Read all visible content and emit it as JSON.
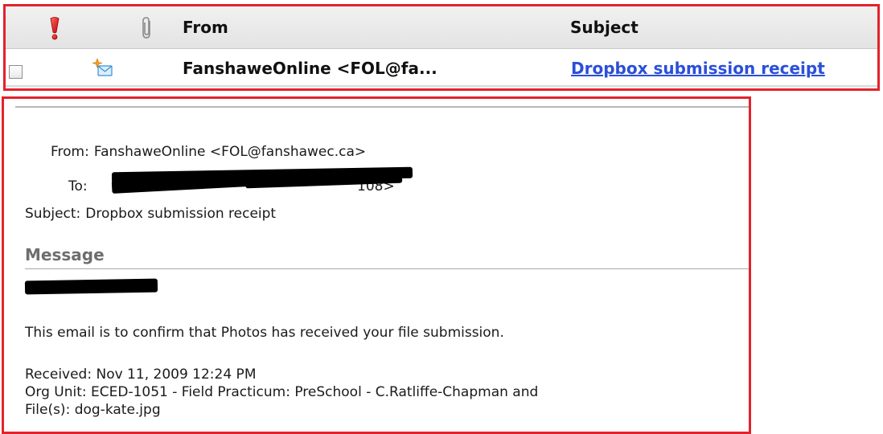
{
  "inbox": {
    "columns": {
      "importance_icon": "red-exclamation-icon",
      "attachment_icon": "paperclip-icon",
      "from": "From",
      "subject": "Subject"
    },
    "rows": [
      {
        "checked": false,
        "status_icon": "new-unread-envelope-icon",
        "from": "FanshaweOnline <FOL@fa...",
        "subject": "Dropbox submission receipt"
      }
    ]
  },
  "message": {
    "from_label": "From:",
    "from_value": "FanshaweOnline <FOL@fanshawec.ca>",
    "to_label": "To:",
    "to_visible_tail": "108>",
    "subject_label": "Subject:",
    "subject_value": "Dropbox submission receipt",
    "section_title": "Message",
    "body": [
      "This email is to confirm that Photos has received your file submission.",
      "Received: Nov 11, 2009 12:24 PM",
      "Org Unit: ECED-1051 - Field Practicum: PreSchool - C.Ratliffe-Chapman and",
      "File(s): dog-kate.jpg"
    ]
  },
  "colors": {
    "highlight_border": "#e2222c",
    "link": "#2b4fd8",
    "section_title": "#6e6e6e"
  }
}
